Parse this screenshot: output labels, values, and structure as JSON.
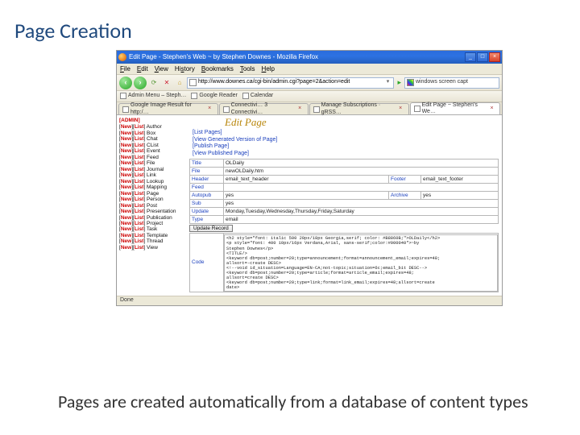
{
  "slide": {
    "title": "Page Creation",
    "caption": "Pages are created automatically from a database of content types"
  },
  "window": {
    "title": "Edit Page - Stephen's Web ~ by Stephen Downes - Mozilla Firefox",
    "minimize": "_",
    "maximize": "□",
    "close": "×"
  },
  "menu": {
    "file": "File",
    "edit": "Edit",
    "view": "View",
    "history": "History",
    "bookmarks": "Bookmarks",
    "tools": "Tools",
    "help": "Help"
  },
  "nav": {
    "url": "http://www.downes.ca/cgi-bin/admin.cgi?page=2&action=edit",
    "search_placeholder": "windows screen capt"
  },
  "bookmarks": [
    "Admin Menu – Steph…",
    "Google Reader",
    "Calendar"
  ],
  "tabs": [
    {
      "label": "Google Image Result for http:/…",
      "active": false
    },
    {
      "label": "Connectivi… 3 Connectivi…",
      "active": false
    },
    {
      "label": "Manage Subscriptions · gRSS…",
      "active": false
    },
    {
      "label": "Edit Page ~ Stephen's We…",
      "active": true
    }
  ],
  "sidebar": {
    "heading": "[ADMIN]",
    "types": [
      "Author",
      "Box",
      "Chat",
      "CList",
      "Event",
      "Feed",
      "File",
      "Journal",
      "Link",
      "Lookup",
      "Mapping",
      "Page",
      "Person",
      "Post",
      "Presentation",
      "Publication",
      "Project",
      "Task",
      "Template",
      "Thread",
      "View"
    ]
  },
  "page": {
    "heading": "Edit Page",
    "links": [
      "List Pages",
      "View Generated Version of Page",
      "Publish Page",
      "View Published Page"
    ],
    "form": {
      "title_lab": "Title",
      "title_val": "OLDaily",
      "file_lab": "File",
      "file_val": "newOLDaily.htm",
      "header_lab": "Header",
      "header_val": "email_text_header",
      "footer_lab": "Footer",
      "footer_val": "email_text_footer",
      "feed_lab": "Feed",
      "feed_val": "",
      "autopub_lab": "Autopub",
      "autopub_val": "yes",
      "archive_lab": "Archive",
      "archive_val": "yes",
      "sub_lab": "Sub",
      "sub_val": "yes",
      "update_lab": "Update",
      "update_val": "Monday,Tuesday,Wednesday,Thursday,Friday,Saturday",
      "type_lab": "Type",
      "type_val": "email",
      "button": "Update Record",
      "code_lab": "Code"
    },
    "code": "<h2 style=\"font: italic 500 20px/18px Georgia,serif; color: #B8860B;\">OLDaily</h2>\n<p style=\"font: 400 10px/16px Verdana,Arial, sans-serif;color:#000040\">~by\nStephen Downes</p>\n<TITLE/>\n<keyword db=post;number=20;type=announcement;format=announcement_email;expires=48;\nallsort=-create DESC>\n<!--void id_situation=Language=EN-CA;not-topic;situation=6c;email_bit DESC-->\n<keyword db=post;number=20;type=article;format=article_email;expires=48;\nallsort=create DESC>\n<keyword db=post;number=20;type=link;format=link_email;expires=48;allsort=create\ndate>"
  },
  "status": {
    "text": "Done"
  }
}
